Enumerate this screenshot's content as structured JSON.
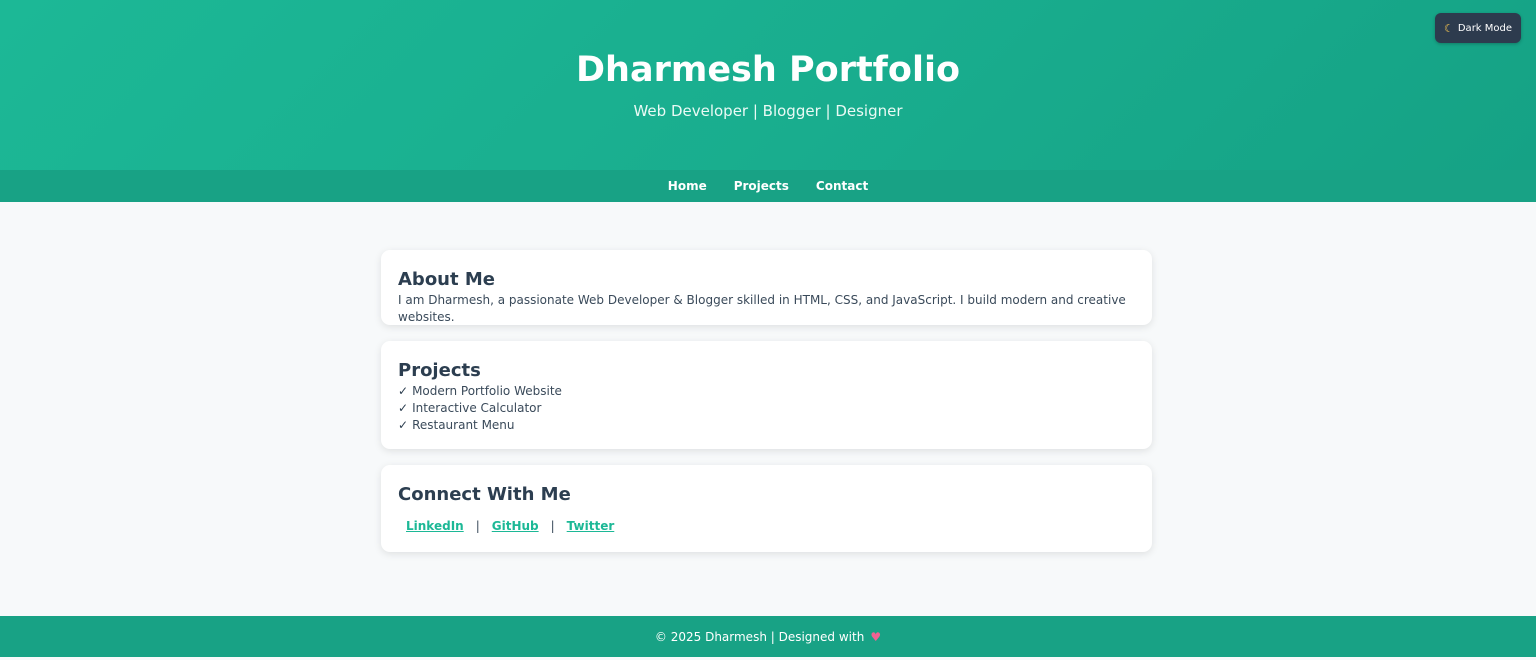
{
  "header": {
    "title": "Dharmesh Portfolio",
    "subtitle": "Web Developer | Blogger | Designer",
    "theme_toggle": {
      "icon": "moon-icon",
      "label": "Dark Mode"
    }
  },
  "nav": {
    "items": [
      {
        "label": "Home"
      },
      {
        "label": "Projects"
      },
      {
        "label": "Contact"
      }
    ]
  },
  "about": {
    "heading": "About Me",
    "text": "I am Dharmesh, a passionate Web Developer & Blogger skilled in HTML, CSS, and JavaScript. I build modern and creative websites."
  },
  "projects": {
    "heading": "Projects",
    "check_glyph": "✓",
    "items": [
      "Modern Portfolio Website",
      "Interactive Calculator",
      "Restaurant Menu"
    ]
  },
  "connect": {
    "heading": "Connect With Me",
    "separator": "|",
    "links": [
      {
        "label": "LinkedIn"
      },
      {
        "label": "GitHub"
      },
      {
        "label": "Twitter"
      }
    ]
  },
  "footer": {
    "text": "© 2025 Dharmesh | Designed with",
    "icon": "heart-icon"
  },
  "colors": {
    "brand": "#1cb896",
    "nav_bg": "#18a285",
    "toggle_bg": "#2d3b4e",
    "text": "#2c3e50",
    "page_bg": "#f7f9fa"
  }
}
